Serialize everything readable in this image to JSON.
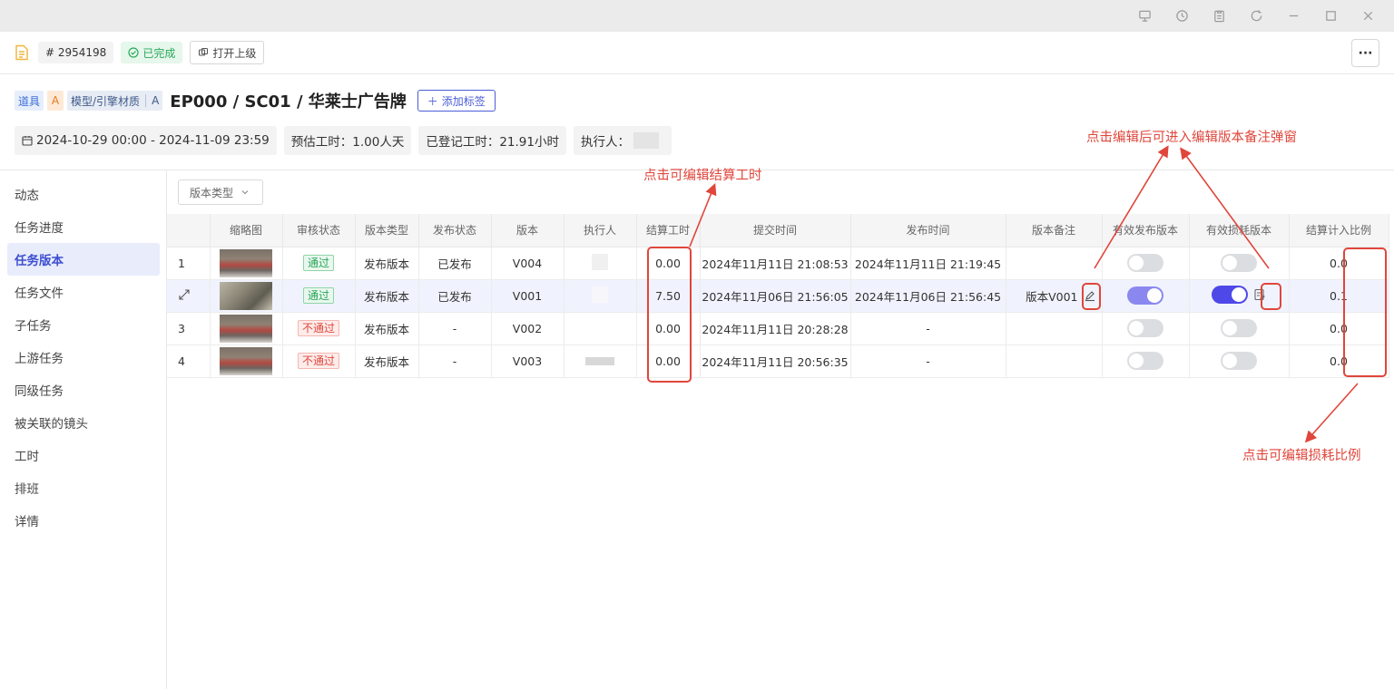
{
  "window": {
    "buttons": [
      "presentation-icon",
      "history-icon",
      "clipboard-icon",
      "refresh-icon",
      "minimize-icon",
      "maximize-icon",
      "close-icon"
    ]
  },
  "topbar": {
    "task_id": "# 2954198",
    "status": "已完成",
    "open_parent": "打开上级",
    "more": "···"
  },
  "header": {
    "tag_type": "道具",
    "tag_level": "A",
    "tag_category": "模型/引擎材质",
    "tag_category_level": "A",
    "title": "EP000 / SC01 / 华莱士广告牌",
    "add_tag": "添加标签"
  },
  "info": {
    "date_range": "2024-10-29 00:00 - 2024-11-09 23:59",
    "estimated": "预估工时：1.00人天",
    "logged": "已登记工时：21.91小时",
    "executor": "执行人："
  },
  "sidebar": {
    "items": [
      "动态",
      "任务进度",
      "任务版本",
      "任务文件",
      "子任务",
      "上游任务",
      "同级任务",
      "被关联的镜头",
      "工时",
      "排班",
      "详情"
    ],
    "active": "任务版本"
  },
  "filter": {
    "label": "版本类型"
  },
  "table": {
    "columns": [
      "",
      "缩略图",
      "审核状态",
      "版本类型",
      "发布状态",
      "版本",
      "执行人",
      "结算工时",
      "提交时间",
      "发布时间",
      "版本备注",
      "有效发布版本",
      "有效损耗版本",
      "结算计入比例"
    ],
    "rows": [
      {
        "index": "1",
        "review": "通过",
        "review_ok": true,
        "type": "发布版本",
        "publish": "已发布",
        "version": "V004",
        "hours": "0.00",
        "submit": "2024年11月11日 21:08:53",
        "published": "2024年11月11日 21:19:45",
        "note": "",
        "valid_publish": false,
        "valid_loss": false,
        "ratio": "0.0"
      },
      {
        "index": "",
        "review": "通过",
        "review_ok": true,
        "type": "发布版本",
        "publish": "已发布",
        "version": "V001",
        "hours": "7.50",
        "submit": "2024年11月06日 21:56:05",
        "published": "2024年11月06日 21:56:45",
        "note": "版本V001",
        "valid_publish": true,
        "valid_loss": true,
        "ratio": "0.1"
      },
      {
        "index": "3",
        "review": "不通过",
        "review_ok": false,
        "type": "发布版本",
        "publish": "-",
        "version": "V002",
        "hours": "0.00",
        "submit": "2024年11月11日 20:28:28",
        "published": "-",
        "note": "",
        "valid_publish": false,
        "valid_loss": false,
        "ratio": "0.0"
      },
      {
        "index": "4",
        "review": "不通过",
        "review_ok": false,
        "type": "发布版本",
        "publish": "-",
        "version": "V003",
        "hours": "0.00",
        "submit": "2024年11月11日 20:56:35",
        "published": "-",
        "note": "",
        "valid_publish": false,
        "valid_loss": false,
        "ratio": "0.0"
      }
    ]
  },
  "annotations": {
    "hours": "点击可编辑结算工时",
    "note": "点击编辑后可进入编辑版本备注弹窗",
    "ratio": "点击可编辑损耗比例"
  },
  "colors": {
    "accent": "#4f48e8",
    "annotation": "#e0463b",
    "pass": "#27a55a",
    "fail": "#e0473c"
  }
}
